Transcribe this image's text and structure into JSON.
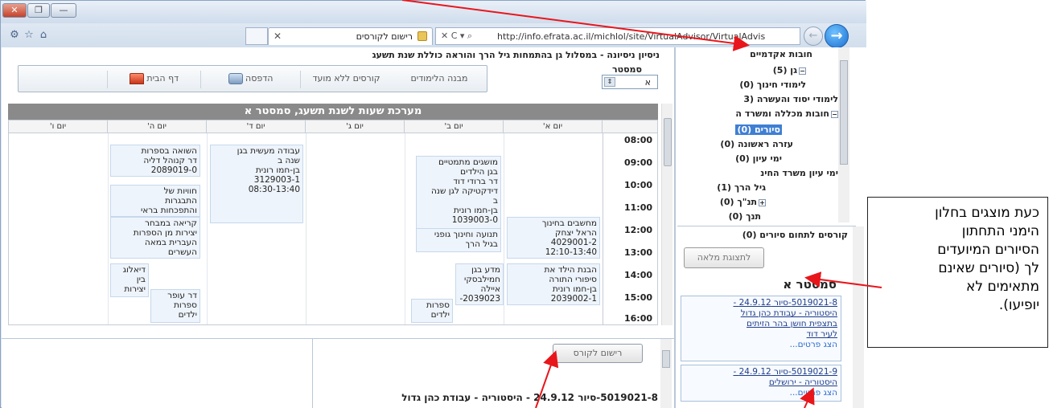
{
  "browser": {
    "window_buttons": {
      "close": "✕",
      "maximize": "❐",
      "minimize": "—"
    },
    "tab_label": "רישום לקורסים",
    "address_controls": "✕ C ▾ ⌕",
    "url": "http://info.efrata.ac.il/michlol/site/VirtualAdvisor/VirtualAdvis",
    "icons": [
      "gear-icon",
      "star-icon",
      "home-icon"
    ]
  },
  "page": {
    "heading": "ניסיון ניסיונה - במסלול גן בהתמחות גיל הרך והוראה כוללת שנת תשעג",
    "semester_label": "סמסטר",
    "semester_value": "א",
    "nav": {
      "structure": "מבנה הלימודים",
      "unscheduled": "קורסים ללא מועד",
      "print": "הדפסה",
      "home": "דף הבית"
    },
    "schedule_title": "מערכת שעות לשנת תשעג, סמסטר א",
    "days": [
      "יום א'",
      "יום ב'",
      "יום ג'",
      "יום ד'",
      "יום ה'",
      "יום ו'"
    ],
    "times": [
      "08:00",
      "09:00",
      "10:00",
      "11:00",
      "12:00",
      "13:00",
      "14:00",
      "15:00",
      "16:00"
    ],
    "courses": [
      {
        "lines": [
          "מושגים מתמטיים",
          "בגן הילדים",
          "דר ברודי דוד",
          "דידקטיקה לגן שנה",
          "ב",
          "בן-חמו רונית",
          "1039003-0"
        ]
      },
      {
        "lines": [
          "עבודה מעשית בגן",
          "שנה ב",
          "בן-חמו רונית",
          "3129003-1",
          "08:30-13:40"
        ]
      },
      {
        "lines": [
          "השואה בספרות",
          "דר קנוהל דליה",
          "2089019-0"
        ]
      },
      {
        "lines": [
          "חוויות של",
          "התבגרות",
          "והתפכחות בראי"
        ]
      },
      {
        "lines": [
          "קריאה במבחר",
          "יצירות מן הספרות",
          "העברית במאה",
          "העשרים"
        ]
      },
      {
        "lines": [
          "מחשבים בחינוך",
          "הראל יצחק",
          "4029001-2",
          "12:10-13:40"
        ]
      },
      {
        "lines": [
          "תנועה וחינוך גופני",
          "בגיל הרך"
        ]
      },
      {
        "lines": [
          "הבנת הילד את",
          "סיפורי התורה",
          "בן-חמו רונית",
          "2039002-1"
        ]
      },
      {
        "lines": [
          "מדע בגן",
          "חמילבסקי",
          "איילה",
          "2039023-"
        ]
      },
      {
        "lines": [
          "ספרות",
          "ילדים"
        ]
      },
      {
        "lines": [
          "דיאלוג",
          "בין",
          "יצירות"
        ]
      },
      {
        "lines": [
          "ספרות",
          "ילדים"
        ]
      },
      {
        "lines": [
          "דר עופר"
        ]
      }
    ],
    "register_button": "רישום לקורס",
    "detail_text": "5019021-8-סיור 24.9.12 - היסטוריה - עבודת כהן גדול"
  },
  "tree": {
    "root": "חובות אקדמיים",
    "items": [
      {
        "label": "גן (5)",
        "toggle": "−"
      },
      {
        "label": "לימודי חינוך (0)"
      },
      {
        "label": "לימודי יסוד והעשרה (3"
      },
      {
        "label": "חובות מכללה ומשרד ה",
        "toggle": "−"
      },
      {
        "label": "סיורים (0)",
        "selected": true
      },
      {
        "label": "עזרה ראשונה (0)"
      },
      {
        "label": "ימי עיון (0)"
      },
      {
        "label": "ימי עיון משרד החינ"
      },
      {
        "label": "גיל הרך (1)"
      },
      {
        "label": "תנ\"ך (0)",
        "toggle": "+"
      },
      {
        "label": "תנך (0)"
      }
    ]
  },
  "courses_panel": {
    "heading": "קורסים לתחום סיורים (0)",
    "full_view": "לתצוגת מלאה",
    "semester_heading": "סמסטר א",
    "tours": [
      {
        "lines": [
          "5019021-8-סיור 24.9.12 -",
          "היסטוריה - עבודת כהן גדול",
          "בתצפית חושן בהר הזיתים",
          "לעיר דוד"
        ],
        "more": "הצג פרטים..."
      },
      {
        "lines": [
          "5019021-9-סיור 24.9.12 -",
          "היסטוריה - ירושלים"
        ],
        "more": "הצג פרטים..."
      }
    ]
  },
  "callout": {
    "lines": [
      "כעת מוצגים בחלון",
      "הימני התחתון",
      "הסיורים המיועדים",
      "לך (סיורים שאינם",
      "מתאימים לא",
      "יופיעו)."
    ]
  },
  "colors": {
    "arrow": "#e8161b",
    "selection": "#3f7fd4",
    "title_bar": "#8a8a8a"
  }
}
